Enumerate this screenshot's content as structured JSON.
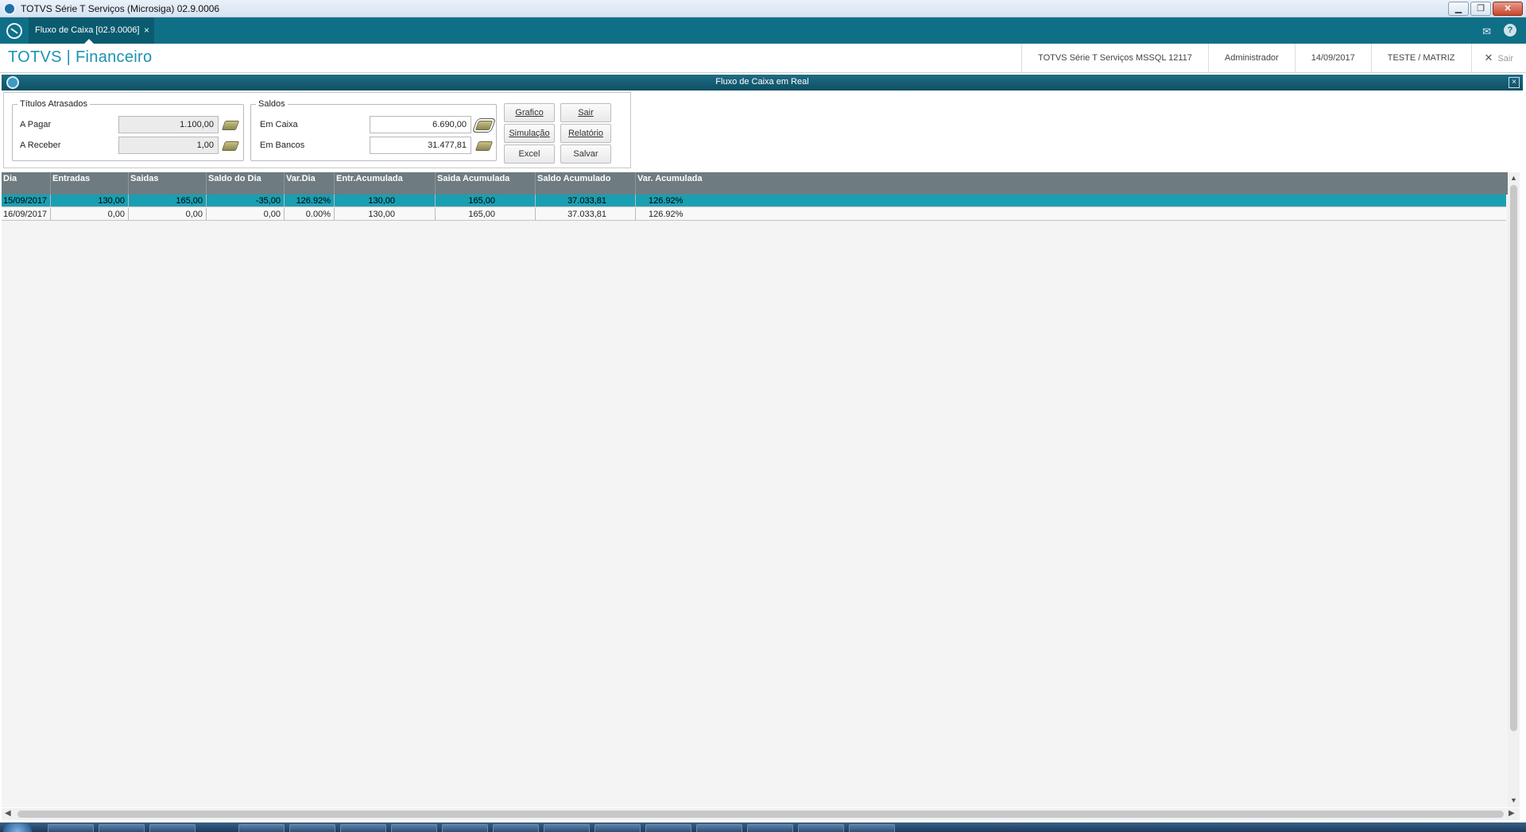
{
  "window": {
    "title": "TOTVS Série T Serviços (Microsiga) 02.9.0006"
  },
  "tab": {
    "label": "Fluxo de Caixa [02.9.0006]",
    "close": "×"
  },
  "app": {
    "brand": "TOTVS | Financeiro",
    "env": "TOTVS Série T Serviços MSSQL 12117",
    "user": "Administrador",
    "date": "14/09/2017",
    "company": "TESTE / MATRIZ",
    "exit_label": "Sair"
  },
  "dialog": {
    "title": "Fluxo de Caixa em  Real",
    "close": "×"
  },
  "titulos": {
    "legend": "Títulos Atrasados",
    "pagar_label": "A Pagar",
    "pagar_value": "1.100,00",
    "receber_label": "A Receber",
    "receber_value": "1,00"
  },
  "saldos": {
    "legend": "Saldos",
    "caixa_label": "Em Caixa",
    "caixa_value": "6.690,00",
    "bancos_label": "Em Bancos",
    "bancos_value": "31.477,81"
  },
  "buttons": {
    "grafico": "Grafico",
    "sair": "Sair",
    "simulacao": "Simulação",
    "relatorio": "Relatório",
    "excel": "Excel",
    "salvar": "Salvar"
  },
  "grid": {
    "columns": [
      "Dia",
      "Entradas",
      "Saidas",
      "Saldo do Dia",
      "Var.Dia",
      "Entr.Acumulada",
      "Saida Acumulada",
      "Saldo Acumulado",
      "Var. Acumulada"
    ],
    "rows": [
      [
        "15/09/2017",
        "130,00",
        "165,00",
        "-35,00",
        "126.92%",
        "130,00",
        "165,00",
        "37.033,81",
        "126.92%"
      ],
      [
        "16/09/2017",
        "0,00",
        "0,00",
        "0,00",
        "0.00%",
        "130,00",
        "165,00",
        "37.033,81",
        "126.92%"
      ]
    ],
    "selected_row": 0
  },
  "colors": {
    "accent": "#0f6f86",
    "brand": "#1a93b3",
    "selected_row": "#1a9fb2",
    "grid_header": "#6e7b80"
  }
}
